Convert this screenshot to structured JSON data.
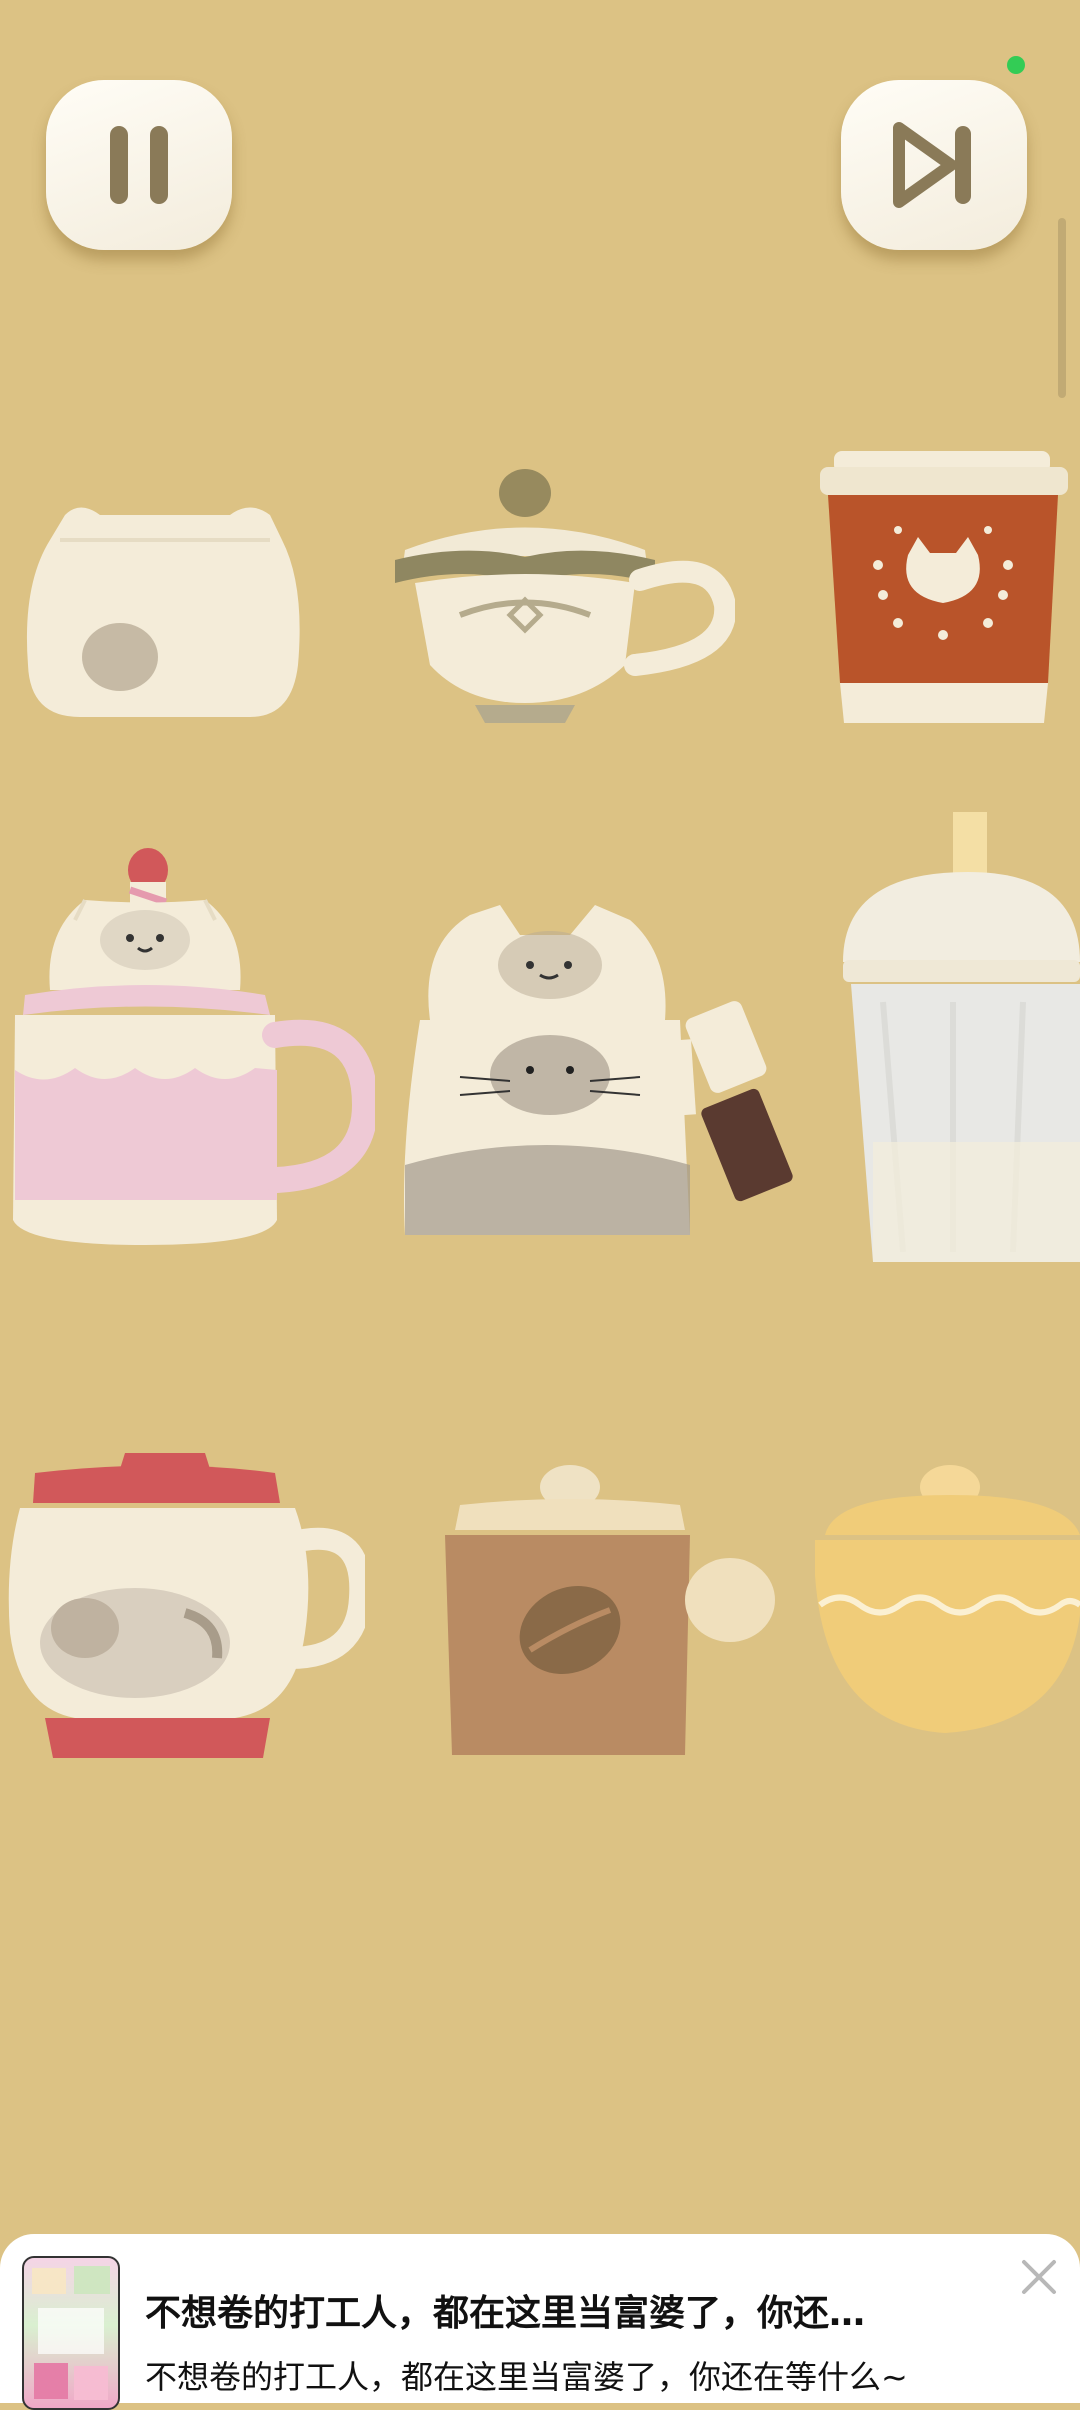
{
  "controls": {
    "pause_icon": "pause-icon",
    "skip_icon": "skip-forward-icon"
  },
  "shelf": {
    "rows": [
      [
        "round-lidded-jar",
        "ornate-teacup",
        "cat-coffee-to-go-cup"
      ],
      [
        "birthday-cat-mug",
        "cat-teapot-mug",
        "iced-drink-cup"
      ],
      [
        "sleeping-cat-jar",
        "coffee-bean-mug",
        "yellow-sugar-bowl"
      ]
    ]
  },
  "ad": {
    "title": "不想卷的打工人，都在这里当富婆了，你还…",
    "subtitle": "不想卷的打工人，都在这里当富婆了，你还在等什么~",
    "close_icon": "close-icon"
  },
  "colors": {
    "background": "#dcc284",
    "cream": "#f4ecd9",
    "rust": "#b9542a",
    "pink": "#eec9d5",
    "red": "#d1585a",
    "brown": "#b98b63",
    "yellow": "#f0cc79",
    "status_dot": "#33cc55"
  }
}
